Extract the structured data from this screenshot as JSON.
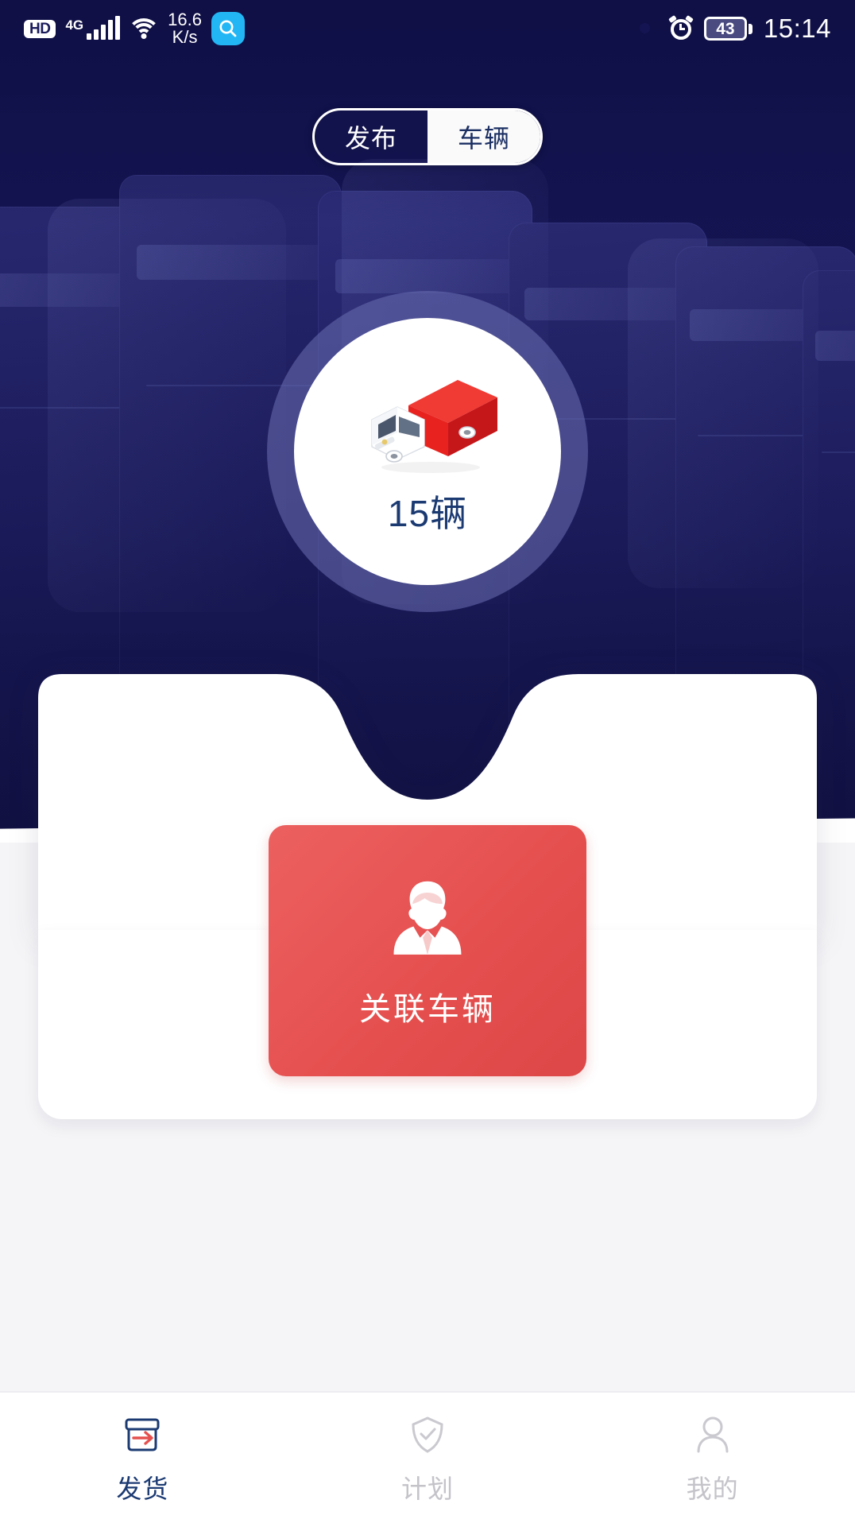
{
  "status_bar": {
    "hd_label": "HD",
    "network_type": "4G",
    "net_speed_value": "16.6",
    "net_speed_unit": "K/s",
    "search_icon": "search-icon",
    "wifi_icon": "wifi-icon",
    "signal_icon": "signal-bars-icon",
    "eye_icon": "eye-icon",
    "alarm_icon": "alarm-clock-icon",
    "battery_level": "43",
    "time": "15:14"
  },
  "segmented_control": {
    "options": [
      {
        "label": "发布",
        "selected": true
      },
      {
        "label": "车辆",
        "selected": false
      }
    ]
  },
  "vehicle_circle": {
    "icon": "delivery-truck-illustration",
    "count_text": "15辆"
  },
  "action_card": {
    "icon": "person-in-suit-icon",
    "label": "关联车辆"
  },
  "bottom_nav": {
    "items": [
      {
        "label": "发货",
        "icon": "package-arrow-icon",
        "active": true
      },
      {
        "label": "计划",
        "icon": "shield-check-icon",
        "active": false
      },
      {
        "label": "我的",
        "icon": "person-outline-icon",
        "active": false
      }
    ]
  },
  "colors": {
    "hero_navy": "#141452",
    "accent_red": "#e5504f",
    "active_nav": "#1b3a72",
    "idle_nav": "#c3c3c9",
    "search_chip": "#22b6f5",
    "truck_body_red": "#e8231f"
  }
}
